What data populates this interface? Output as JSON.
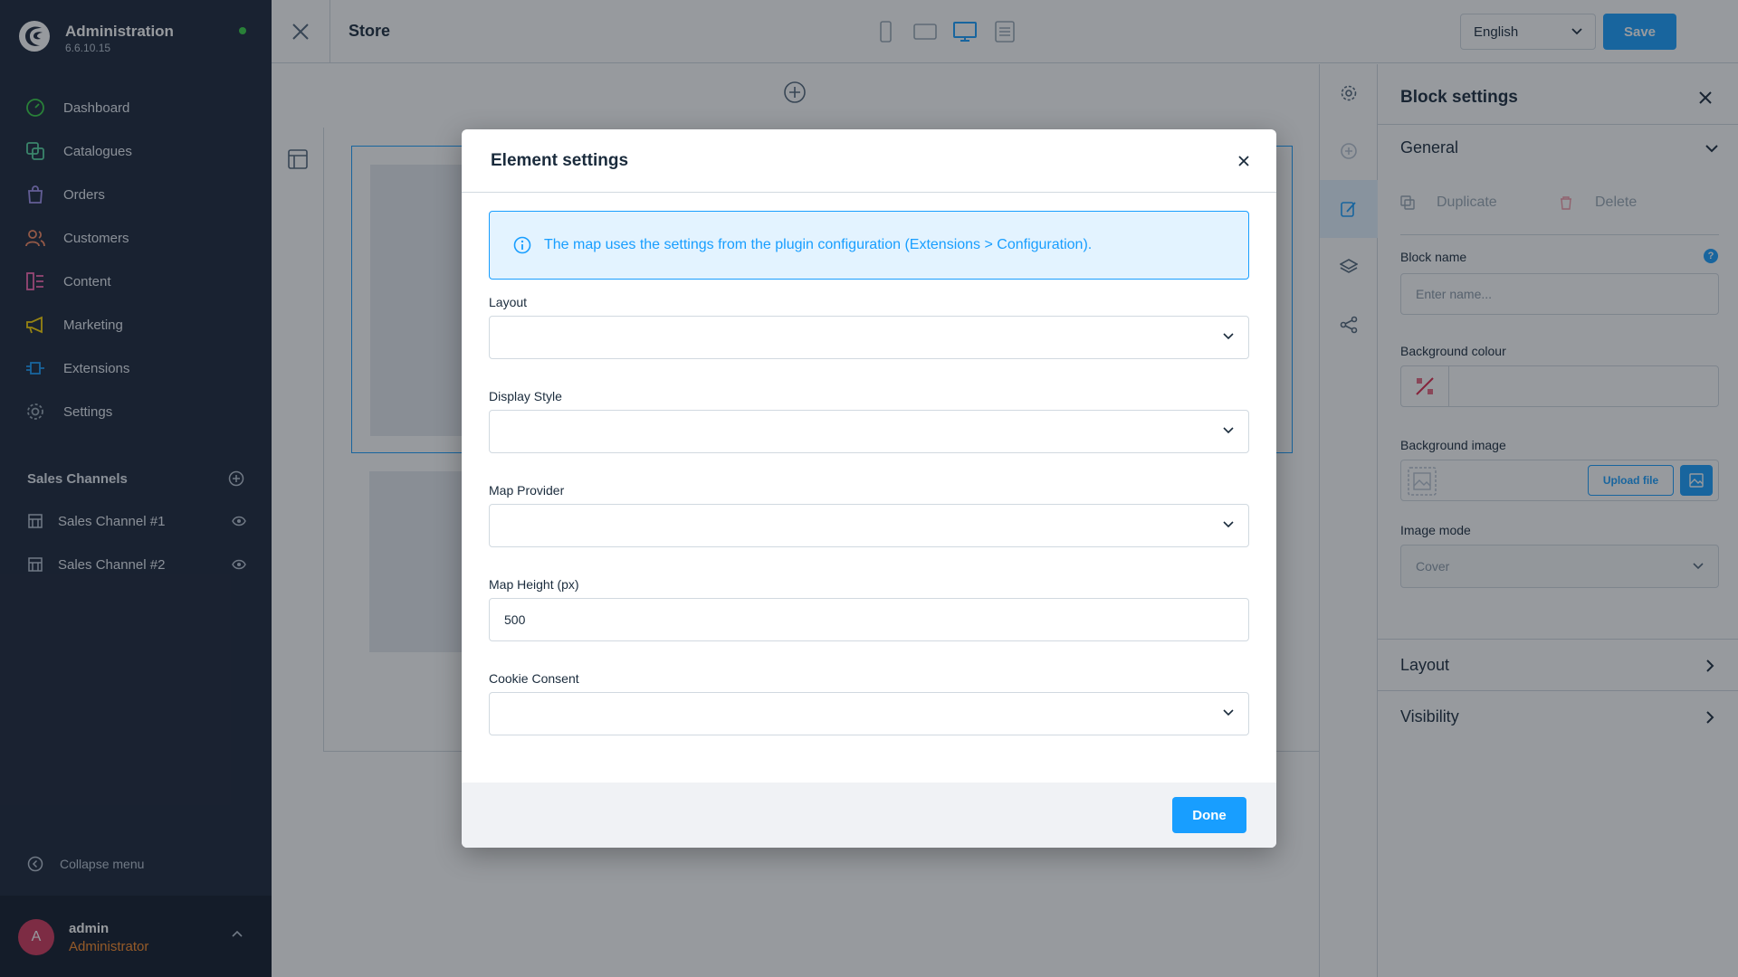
{
  "app": {
    "title": "Administration",
    "version": "6.6.10.15"
  },
  "nav": {
    "items": [
      {
        "label": "Dashboard",
        "icon": "dashboard-icon",
        "color": "#37d046"
      },
      {
        "label": "Catalogues",
        "icon": "catalogue-icon",
        "color": "#57d9a3"
      },
      {
        "label": "Orders",
        "icon": "orders-icon",
        "color": "#a092f0"
      },
      {
        "label": "Customers",
        "icon": "customers-icon",
        "color": "#f88962"
      },
      {
        "label": "Content",
        "icon": "content-icon",
        "color": "#ff68b4"
      },
      {
        "label": "Marketing",
        "icon": "marketing-icon",
        "color": "#ffd700"
      },
      {
        "label": "Extensions",
        "icon": "extensions-icon",
        "color": "#189eff"
      },
      {
        "label": "Settings",
        "icon": "settings-icon",
        "color": "#9aa8b5"
      }
    ]
  },
  "sales_channels": {
    "header": "Sales Channels",
    "items": [
      {
        "label": "Sales Channel #1"
      },
      {
        "label": "Sales Channel #2"
      }
    ]
  },
  "collapse_label": "Collapse menu",
  "user": {
    "initial": "A",
    "name": "admin",
    "role": "Administrator"
  },
  "topbar": {
    "title": "Store",
    "language": "English",
    "save_label": "Save"
  },
  "panel": {
    "title": "Block settings",
    "general_label": "General",
    "duplicate_label": "Duplicate",
    "delete_label": "Delete",
    "block_name_label": "Block name",
    "block_name_placeholder": "Enter name...",
    "bg_colour_label": "Background colour",
    "bg_image_label": "Background image",
    "upload_label": "Upload file",
    "image_mode_label": "Image mode",
    "image_mode_value": "Cover",
    "layout_label": "Layout",
    "visibility_label": "Visibility",
    "help_glyph": "?"
  },
  "modal": {
    "title": "Element settings",
    "info_text": "The map uses the settings from the plugin configuration (Extensions > Configuration).",
    "layout_label": "Layout",
    "display_style_label": "Display Style",
    "map_provider_label": "Map Provider",
    "map_height_label": "Map Height (px)",
    "map_height_value": "500",
    "cookie_consent_label": "Cookie Consent",
    "done_label": "Done"
  },
  "colors": {
    "sidebar": "#1b2539",
    "accent": "#189eff",
    "role": "#f98b2a",
    "status": "#37d046"
  }
}
